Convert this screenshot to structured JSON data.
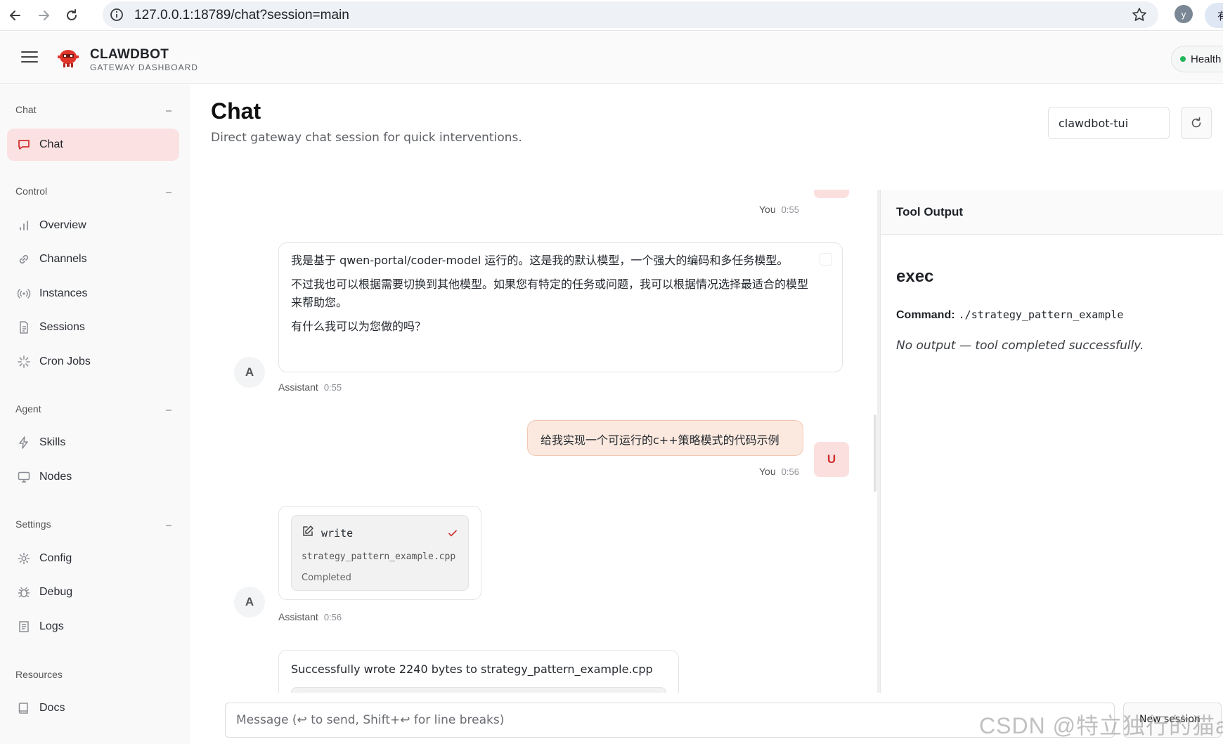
{
  "browser": {
    "url": "127.0.0.1:18789/chat?session=main",
    "profile_initial": "y",
    "profile_ext": "有"
  },
  "header": {
    "brand_title": "CLAWDBOT",
    "brand_subtitle": "GATEWAY DASHBOARD",
    "health_label": "Health",
    "health_color": "#22b55a"
  },
  "sidebar": {
    "groups": [
      {
        "label": "Chat",
        "items": [
          {
            "label": "Chat",
            "icon": "chat-bubble-icon",
            "active": true
          }
        ]
      },
      {
        "label": "Control",
        "items": [
          {
            "label": "Overview",
            "icon": "bar-chart-icon"
          },
          {
            "label": "Channels",
            "icon": "link-icon"
          },
          {
            "label": "Instances",
            "icon": "radio-signal-icon"
          },
          {
            "label": "Sessions",
            "icon": "document-icon"
          },
          {
            "label": "Cron Jobs",
            "icon": "loader-icon"
          }
        ]
      },
      {
        "label": "Agent",
        "items": [
          {
            "label": "Skills",
            "icon": "lightning-icon"
          },
          {
            "label": "Nodes",
            "icon": "monitor-icon"
          }
        ]
      },
      {
        "label": "Settings",
        "items": [
          {
            "label": "Config",
            "icon": "gear-icon"
          },
          {
            "label": "Debug",
            "icon": "bug-icon"
          },
          {
            "label": "Logs",
            "icon": "log-file-icon"
          }
        ]
      },
      {
        "label": "Resources",
        "items": [
          {
            "label": "Docs",
            "icon": "book-icon"
          }
        ]
      }
    ]
  },
  "main": {
    "title": "Chat",
    "subtitle": "Direct gateway chat session for quick interventions.",
    "session_value": "clawdbot-tui"
  },
  "messages": [
    {
      "role": "user",
      "sender": "You",
      "time": "0:55"
    },
    {
      "role": "assistant",
      "sender": "Assistant",
      "time": "0:55",
      "avatar": "A",
      "paragraphs": [
        "我是基于 qwen-portal/coder-model 运行的。这是我的默认模型，一个强大的编码和多任务模型。",
        "不过我也可以根据需要切换到其他模型。如果您有特定的任务或问题，我可以根据情况选择最适合的模型来帮助您。",
        "有什么我可以为您做的吗？"
      ]
    },
    {
      "role": "user",
      "sender": "You",
      "time": "0:56",
      "avatar": "U",
      "text": "给我实现一个可运行的c++策略模式的代码示例"
    },
    {
      "role": "assistant",
      "sender": "Assistant",
      "time": "0:56",
      "avatar": "A",
      "tool": {
        "name": "write",
        "file": "strategy_pattern_example.cpp",
        "status": "Completed"
      }
    },
    {
      "role": "assistant",
      "text": "Successfully wrote 2240 bytes to strategy_pattern_example.cpp"
    }
  ],
  "tool_output": {
    "title": "Tool Output",
    "tool_name": "exec",
    "command_label": "Command:",
    "command": "./strategy_pattern_example",
    "result": "No output — tool completed successfully."
  },
  "composer": {
    "placeholder": "Message (↩ to send, Shift+↩ for line breaks)",
    "new_session_label": "New session"
  },
  "watermark": "CSDN @特立独行的猫a",
  "colors": {
    "accent": "#d22d2d",
    "active_nav_bg": "#fbe1e1",
    "user_bubble_bg": "#fbe9df"
  }
}
